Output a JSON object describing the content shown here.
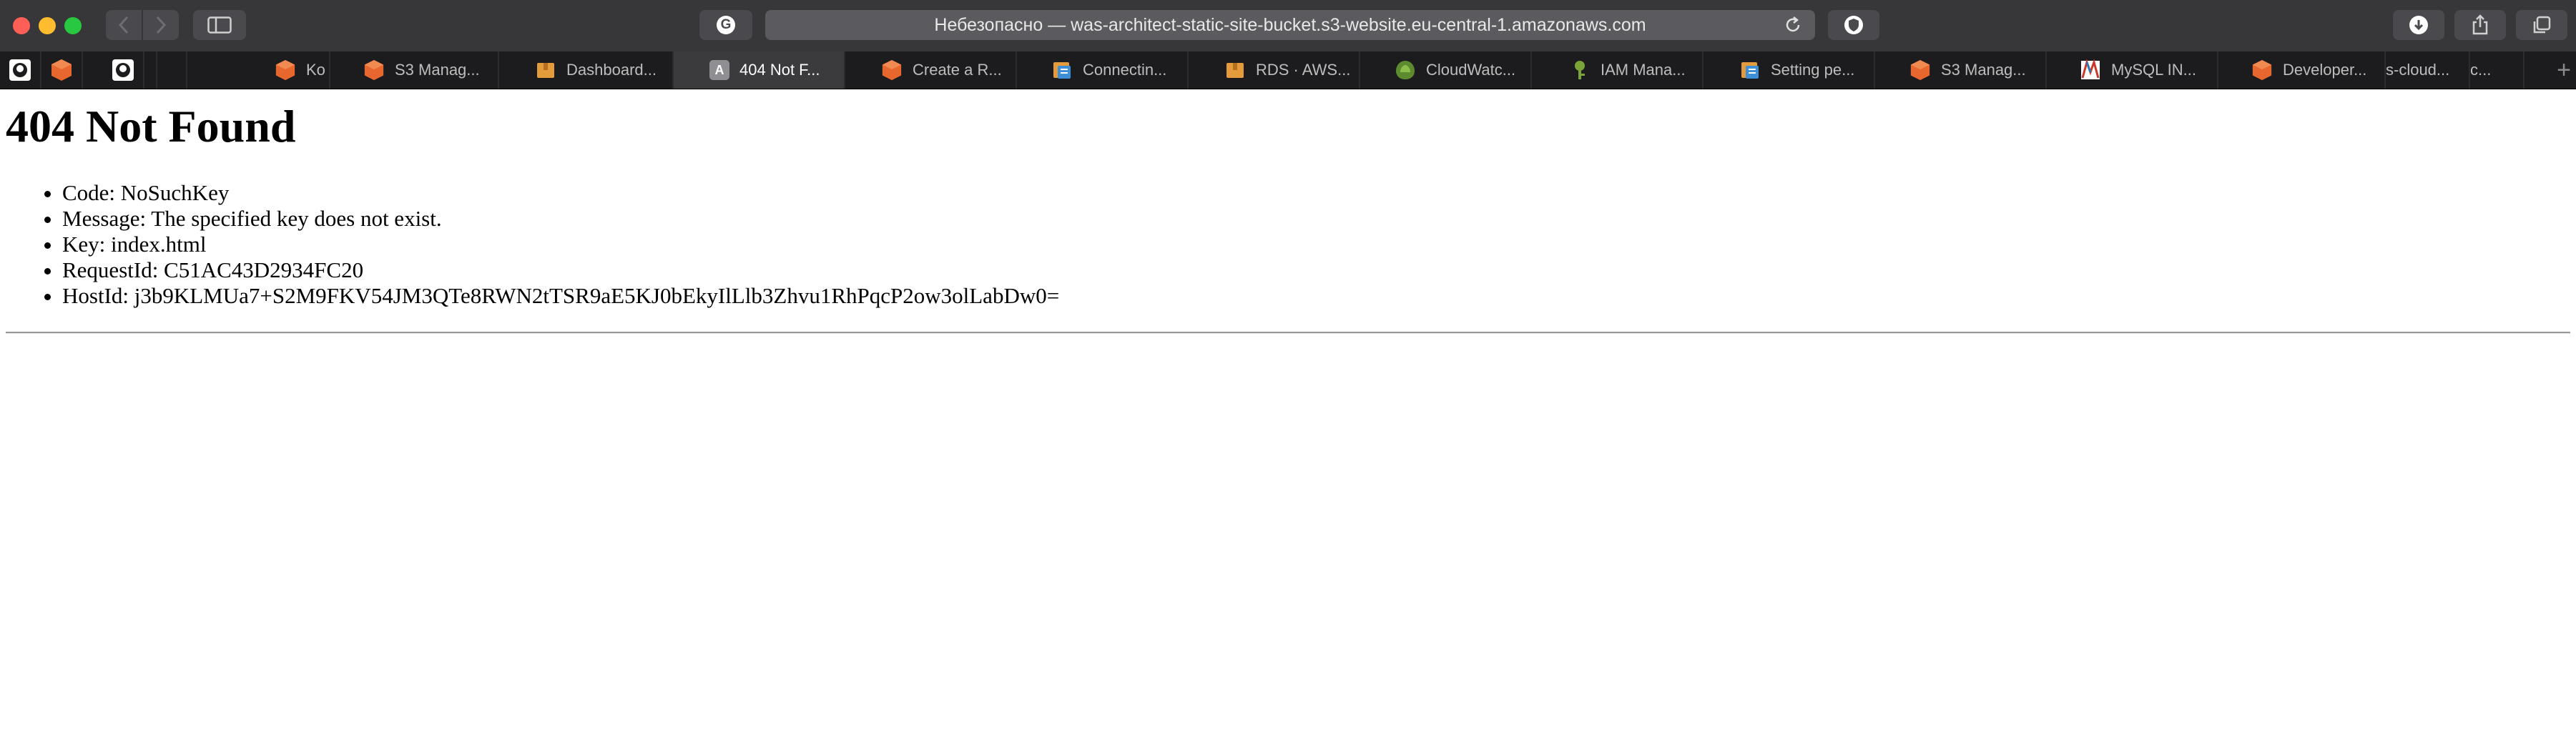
{
  "browser": {
    "address_bar": {
      "text": "Небезопасно — was-architect-static-site-bucket.s3-website.eu-central-1.amazonaws.com"
    },
    "g_button_letter": "G",
    "tabs": [
      {
        "label": "Ko",
        "icon": "aws-cube-icon"
      },
      {
        "label": "S3 Manag...",
        "icon": "aws-cube-icon"
      },
      {
        "label": "Dashboard...",
        "icon": "aws-box-icon"
      },
      {
        "label": "404 Not F...",
        "icon": "letter-a-icon",
        "active": true
      },
      {
        "label": "Create a R...",
        "icon": "aws-cube-icon"
      },
      {
        "label": "Connectin...",
        "icon": "aws-docs-icon"
      },
      {
        "label": "RDS · AWS...",
        "icon": "aws-box-icon"
      },
      {
        "label": "CloudWatc...",
        "icon": "cloudwatch-icon"
      },
      {
        "label": "IAM Mana...",
        "icon": "iam-key-icon"
      },
      {
        "label": "Setting pe...",
        "icon": "aws-docs-icon"
      },
      {
        "label": "S3 Manag...",
        "icon": "aws-cube-icon"
      },
      {
        "label": "MySQL IN...",
        "icon": "mysql-icon"
      },
      {
        "label": "Developer...",
        "icon": "aws-cube-icon"
      },
      {
        "label": "s-cloud...",
        "icon": ""
      },
      {
        "label": "c...",
        "icon": ""
      }
    ],
    "active_tab_letter": "A",
    "new_tab_symbol": "+"
  },
  "page": {
    "heading": "404 Not Found",
    "details": [
      "Code: NoSuchKey",
      "Message: The specified key does not exist.",
      "Key: index.html",
      "RequestId: C51AC43D2934FC20",
      "HostId: j3b9KLMUa7+S2M9FKV54JM3QTe8RWN2tTSR9aE5KJ0bEkyIlLlb3Zhvu1RhPqcP2ow3olLabDw0="
    ]
  },
  "colors": {
    "toolbar_bg": "#37373a",
    "tabstrip_bg": "#1c1c1e",
    "active_tab_bg": "#3b3b3e",
    "aws_orange": "#e8672f",
    "aws_box": "#e39b3c"
  }
}
